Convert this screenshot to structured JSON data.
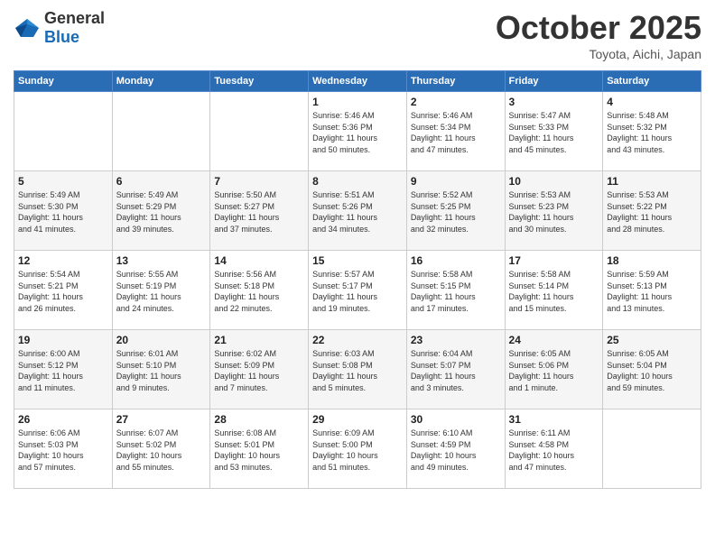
{
  "header": {
    "logo_general": "General",
    "logo_blue": "Blue",
    "month_title": "October 2025",
    "subtitle": "Toyota, Aichi, Japan"
  },
  "weekdays": [
    "Sunday",
    "Monday",
    "Tuesday",
    "Wednesday",
    "Thursday",
    "Friday",
    "Saturday"
  ],
  "weeks": [
    [
      {
        "day": "",
        "info": ""
      },
      {
        "day": "",
        "info": ""
      },
      {
        "day": "",
        "info": ""
      },
      {
        "day": "1",
        "info": "Sunrise: 5:46 AM\nSunset: 5:36 PM\nDaylight: 11 hours\nand 50 minutes."
      },
      {
        "day": "2",
        "info": "Sunrise: 5:46 AM\nSunset: 5:34 PM\nDaylight: 11 hours\nand 47 minutes."
      },
      {
        "day": "3",
        "info": "Sunrise: 5:47 AM\nSunset: 5:33 PM\nDaylight: 11 hours\nand 45 minutes."
      },
      {
        "day": "4",
        "info": "Sunrise: 5:48 AM\nSunset: 5:32 PM\nDaylight: 11 hours\nand 43 minutes."
      }
    ],
    [
      {
        "day": "5",
        "info": "Sunrise: 5:49 AM\nSunset: 5:30 PM\nDaylight: 11 hours\nand 41 minutes."
      },
      {
        "day": "6",
        "info": "Sunrise: 5:49 AM\nSunset: 5:29 PM\nDaylight: 11 hours\nand 39 minutes."
      },
      {
        "day": "7",
        "info": "Sunrise: 5:50 AM\nSunset: 5:27 PM\nDaylight: 11 hours\nand 37 minutes."
      },
      {
        "day": "8",
        "info": "Sunrise: 5:51 AM\nSunset: 5:26 PM\nDaylight: 11 hours\nand 34 minutes."
      },
      {
        "day": "9",
        "info": "Sunrise: 5:52 AM\nSunset: 5:25 PM\nDaylight: 11 hours\nand 32 minutes."
      },
      {
        "day": "10",
        "info": "Sunrise: 5:53 AM\nSunset: 5:23 PM\nDaylight: 11 hours\nand 30 minutes."
      },
      {
        "day": "11",
        "info": "Sunrise: 5:53 AM\nSunset: 5:22 PM\nDaylight: 11 hours\nand 28 minutes."
      }
    ],
    [
      {
        "day": "12",
        "info": "Sunrise: 5:54 AM\nSunset: 5:21 PM\nDaylight: 11 hours\nand 26 minutes."
      },
      {
        "day": "13",
        "info": "Sunrise: 5:55 AM\nSunset: 5:19 PM\nDaylight: 11 hours\nand 24 minutes."
      },
      {
        "day": "14",
        "info": "Sunrise: 5:56 AM\nSunset: 5:18 PM\nDaylight: 11 hours\nand 22 minutes."
      },
      {
        "day": "15",
        "info": "Sunrise: 5:57 AM\nSunset: 5:17 PM\nDaylight: 11 hours\nand 19 minutes."
      },
      {
        "day": "16",
        "info": "Sunrise: 5:58 AM\nSunset: 5:15 PM\nDaylight: 11 hours\nand 17 minutes."
      },
      {
        "day": "17",
        "info": "Sunrise: 5:58 AM\nSunset: 5:14 PM\nDaylight: 11 hours\nand 15 minutes."
      },
      {
        "day": "18",
        "info": "Sunrise: 5:59 AM\nSunset: 5:13 PM\nDaylight: 11 hours\nand 13 minutes."
      }
    ],
    [
      {
        "day": "19",
        "info": "Sunrise: 6:00 AM\nSunset: 5:12 PM\nDaylight: 11 hours\nand 11 minutes."
      },
      {
        "day": "20",
        "info": "Sunrise: 6:01 AM\nSunset: 5:10 PM\nDaylight: 11 hours\nand 9 minutes."
      },
      {
        "day": "21",
        "info": "Sunrise: 6:02 AM\nSunset: 5:09 PM\nDaylight: 11 hours\nand 7 minutes."
      },
      {
        "day": "22",
        "info": "Sunrise: 6:03 AM\nSunset: 5:08 PM\nDaylight: 11 hours\nand 5 minutes."
      },
      {
        "day": "23",
        "info": "Sunrise: 6:04 AM\nSunset: 5:07 PM\nDaylight: 11 hours\nand 3 minutes."
      },
      {
        "day": "24",
        "info": "Sunrise: 6:05 AM\nSunset: 5:06 PM\nDaylight: 11 hours\nand 1 minute."
      },
      {
        "day": "25",
        "info": "Sunrise: 6:05 AM\nSunset: 5:04 PM\nDaylight: 10 hours\nand 59 minutes."
      }
    ],
    [
      {
        "day": "26",
        "info": "Sunrise: 6:06 AM\nSunset: 5:03 PM\nDaylight: 10 hours\nand 57 minutes."
      },
      {
        "day": "27",
        "info": "Sunrise: 6:07 AM\nSunset: 5:02 PM\nDaylight: 10 hours\nand 55 minutes."
      },
      {
        "day": "28",
        "info": "Sunrise: 6:08 AM\nSunset: 5:01 PM\nDaylight: 10 hours\nand 53 minutes."
      },
      {
        "day": "29",
        "info": "Sunrise: 6:09 AM\nSunset: 5:00 PM\nDaylight: 10 hours\nand 51 minutes."
      },
      {
        "day": "30",
        "info": "Sunrise: 6:10 AM\nSunset: 4:59 PM\nDaylight: 10 hours\nand 49 minutes."
      },
      {
        "day": "31",
        "info": "Sunrise: 6:11 AM\nSunset: 4:58 PM\nDaylight: 10 hours\nand 47 minutes."
      },
      {
        "day": "",
        "info": ""
      }
    ]
  ]
}
